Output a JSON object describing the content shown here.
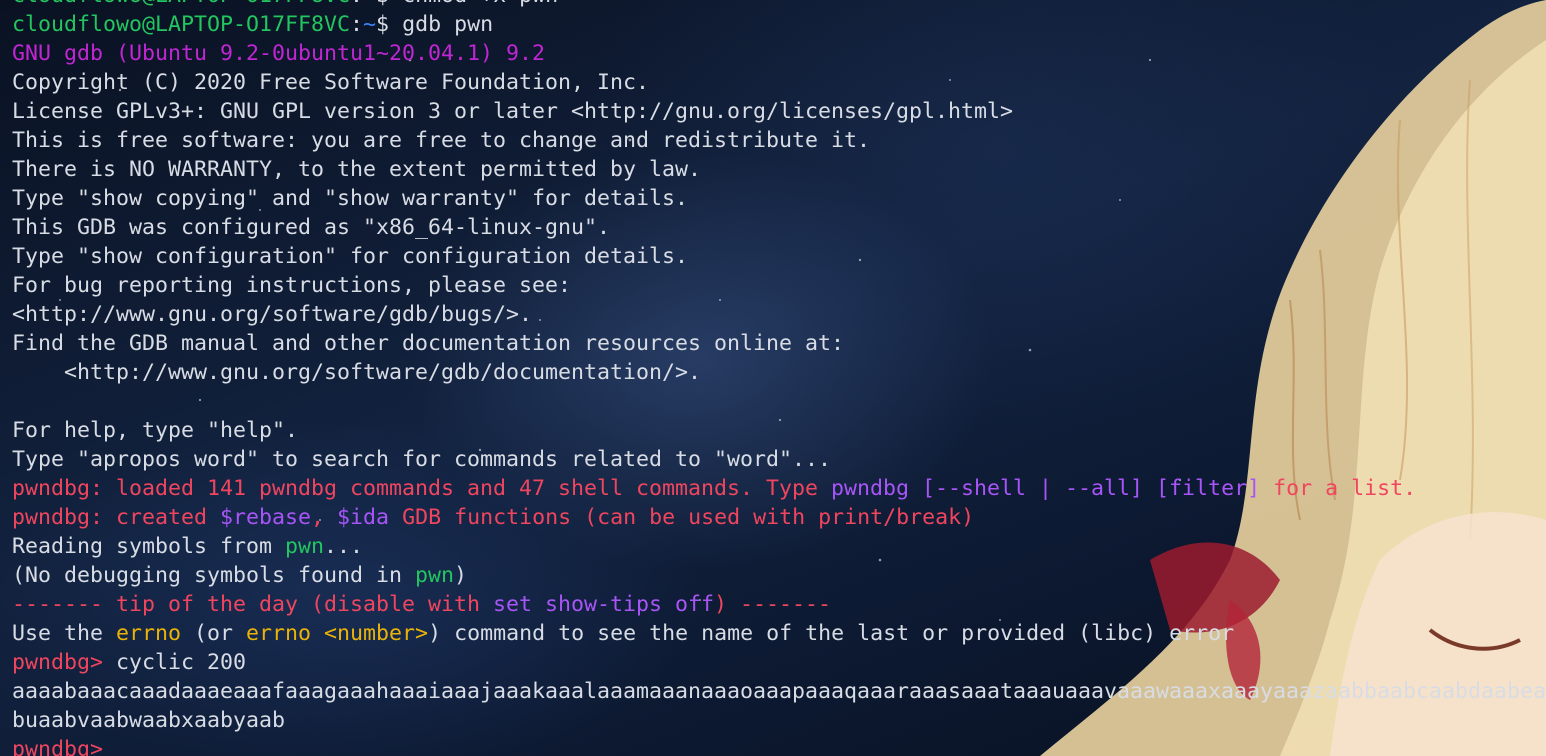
{
  "terminal": {
    "prompt": {
      "user_host": "cloudflowo@LAPTOP-O17FF8VC",
      "sep": ":",
      "path": "~",
      "dollar": "$ "
    },
    "commands": [
      "chmod +x pwn",
      "gdb pwn"
    ],
    "gdb_version": "GNU gdb (Ubuntu 9.2-0ubuntu1~20.04.1) 9.2",
    "banner": [
      "Copyright (C) 2020 Free Software Foundation, Inc.",
      "License GPLv3+: GNU GPL version 3 or later <http://gnu.org/licenses/gpl.html>",
      "This is free software: you are free to change and redistribute it.",
      "There is NO WARRANTY, to the extent permitted by law.",
      "Type \"show copying\" and \"show warranty\" for details.",
      "This GDB was configured as \"x86_64-linux-gnu\".",
      "Type \"show configuration\" for configuration details.",
      "For bug reporting instructions, please see:",
      "<http://www.gnu.org/software/gdb/bugs/>.",
      "Find the GDB manual and other documentation resources online at:",
      "    <http://www.gnu.org/software/gdb/documentation/>."
    ],
    "help": [
      "For help, type \"help\".",
      "Type \"apropos word\" to search for commands related to \"word\"..."
    ],
    "pwndbg_loaded": {
      "prefix": "pwndbg: loaded 141 pwndbg commands and 47 shell commands. Type ",
      "cmd": "pwndbg [--shell | --all] [filter]",
      "suffix": " for a list."
    },
    "pwndbg_created": {
      "a": "pwndbg: created ",
      "rebase": "$rebase",
      "b": ", ",
      "ida": "$ida",
      "c": " GDB functions (can be used with print/break)"
    },
    "reading": {
      "a": "Reading symbols from ",
      "file": "pwn",
      "b": "..."
    },
    "nodebug": {
      "a": "(No debugging symbols found in ",
      "file": "pwn",
      "b": ")"
    },
    "tip_header": {
      "a": "------- tip of the day (disable with ",
      "cmd": "set show-tips off",
      "b": ") -------"
    },
    "tip_body": {
      "a": "Use the ",
      "errno1": "errno",
      "b": " (or ",
      "errno2": "errno <number>",
      "c": ") command to see the name of the last or provided (libc) error"
    },
    "gdb_prompt": "pwndbg> ",
    "gdb_command": "cyclic 200",
    "output": [
      "aaaabaaacaaadaaaeaaafaaagaaahaaaiaaajaaakaaalaaamaaanaaaoaaapaaaqaaaraaasaaataaauaaavaaawaaaxaaayaaazaabbaabcaabdaabeaabfaabgaabhaabiaabjaabkaablaabmaabnaaboaabpaabqaabraabsaabtaab",
      "buaabvaabwaabxaabyaab"
    ],
    "last_prompt": "pwndbg> "
  },
  "colors": {
    "prompt_user": "#22c55e",
    "prompt_path": "#3b82f6",
    "gdb_version": "#c026d3",
    "pwndbg": "#f0455e",
    "pwndbg_cmd": "#a855f7",
    "highlight": "#eab308",
    "text": "#d8dce4"
  }
}
